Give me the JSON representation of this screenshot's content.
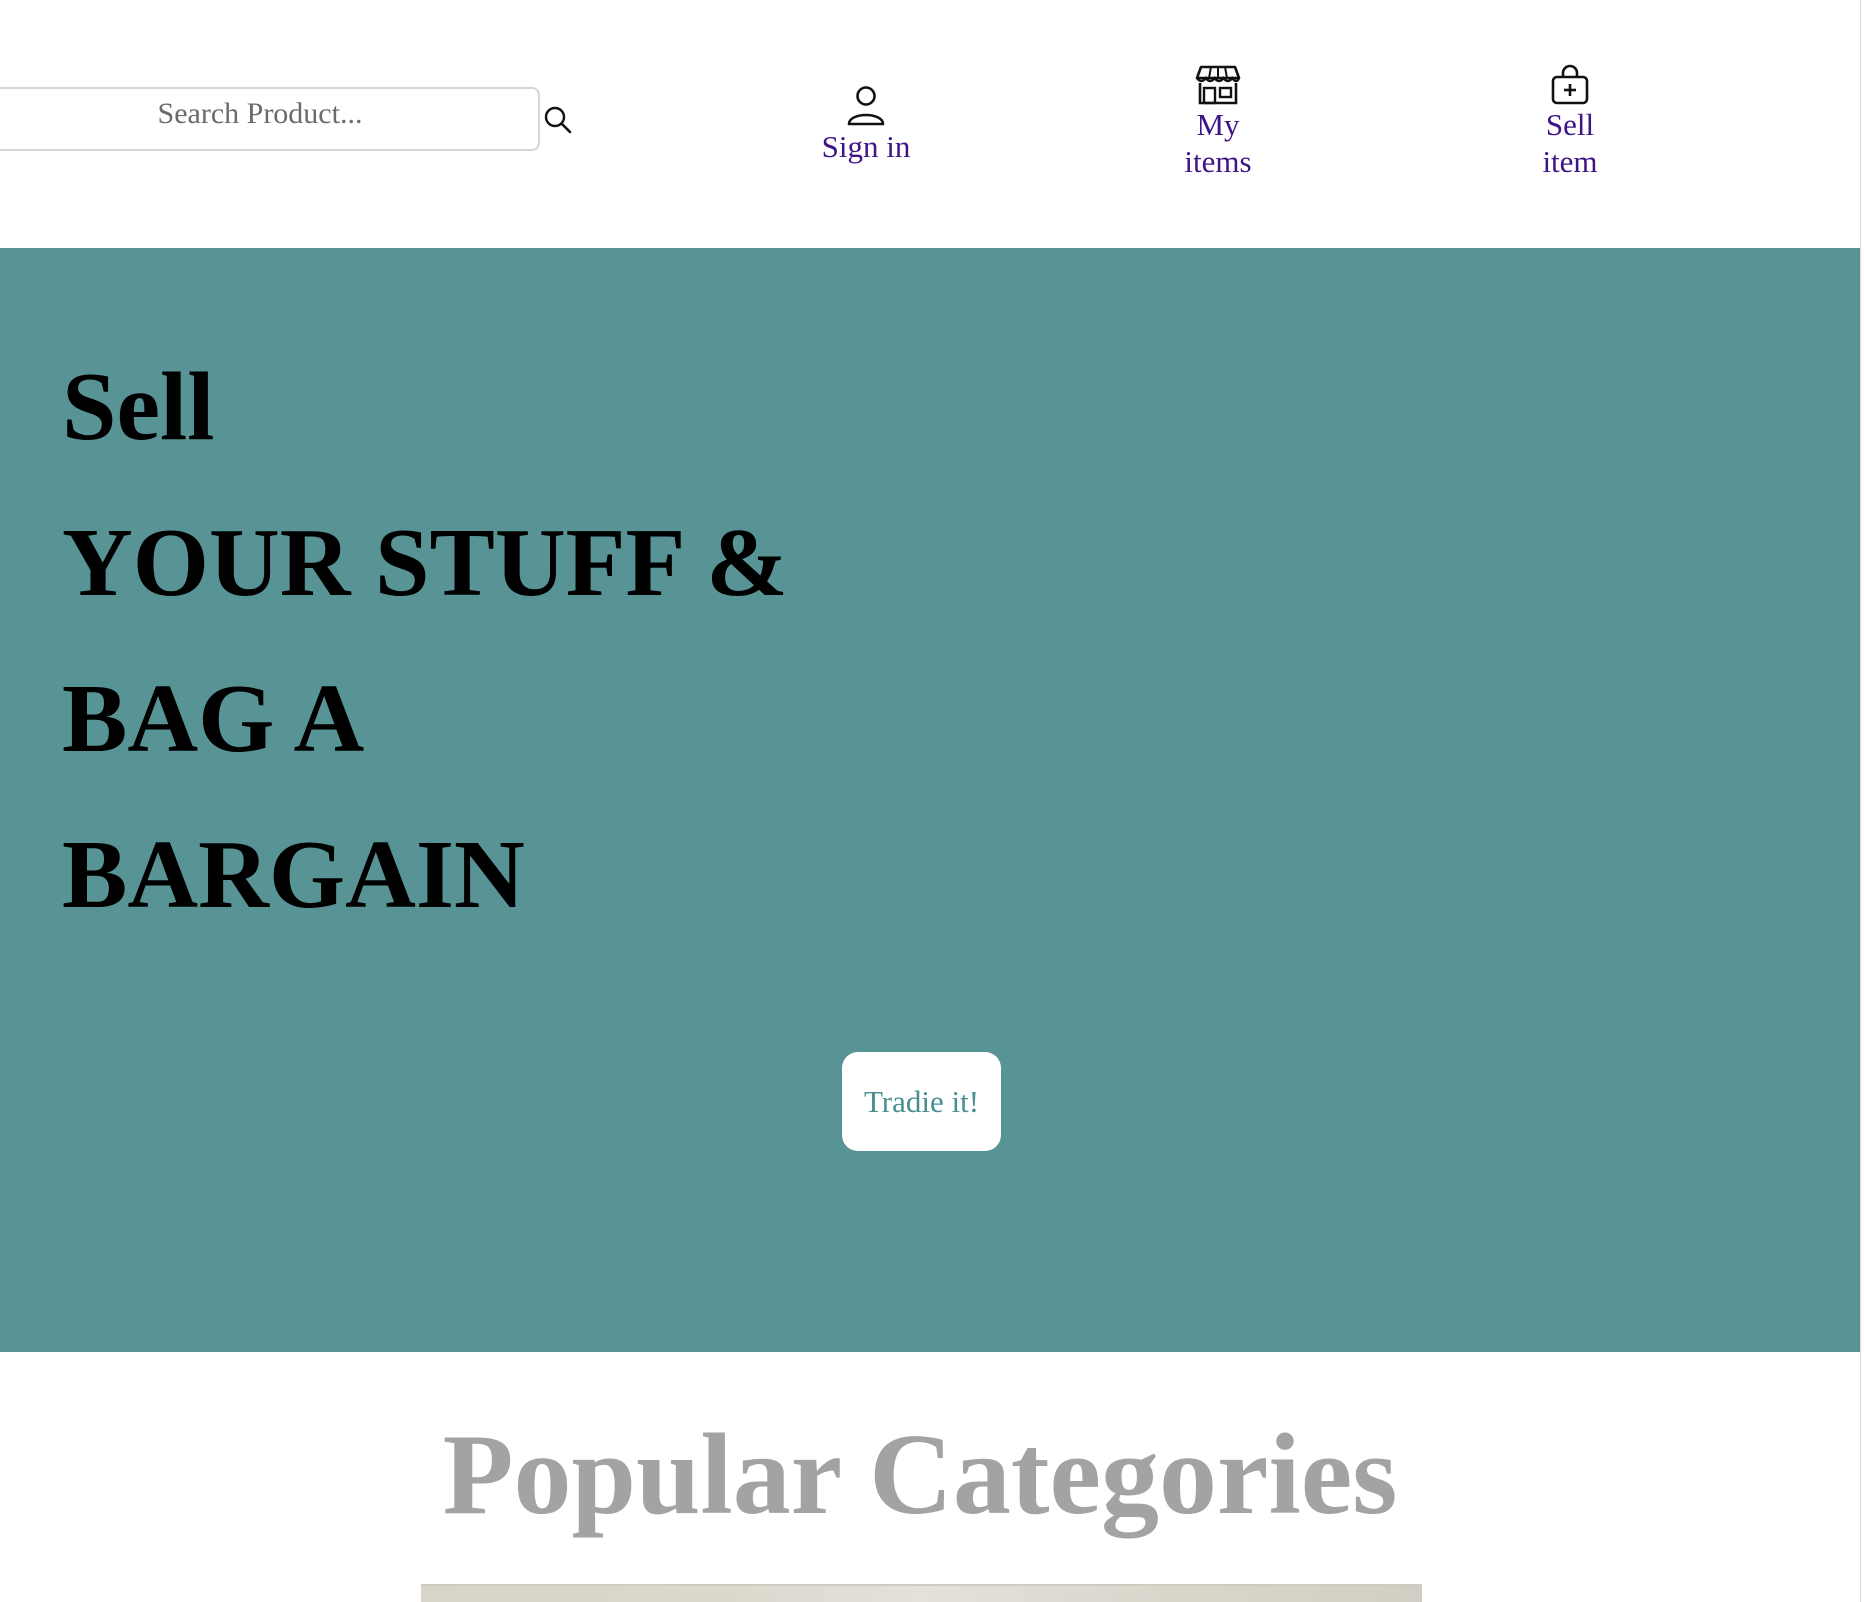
{
  "header": {
    "search": {
      "placeholder": "Search Product...",
      "icon": "search-icon"
    },
    "nav": [
      {
        "label": "Sign in",
        "icon": "user-icon"
      },
      {
        "label": "My\nitems",
        "icon": "storefront-icon"
      },
      {
        "label": "Sell\nitem",
        "icon": "bag-plus-icon"
      }
    ],
    "link_color": "#3d1584"
  },
  "hero": {
    "lines": [
      "Sell",
      "YOUR STUFF &",
      "BAG A",
      "BARGAIN"
    ],
    "cta_label": "Tradie it!",
    "background": "#589495",
    "cta_text_color": "#4a8f90"
  },
  "categories": {
    "title": "Popular Categories",
    "title_color": "#a3a3a3"
  }
}
